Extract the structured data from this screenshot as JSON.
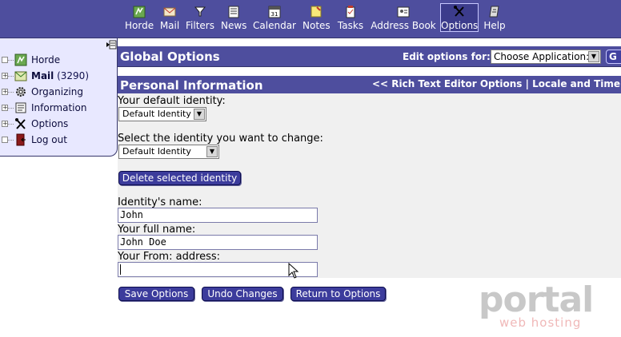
{
  "menu": {
    "items": [
      {
        "label": "Horde",
        "icon": "horde-icon"
      },
      {
        "label": "Mail",
        "icon": "mail-icon"
      },
      {
        "label": "Filters",
        "icon": "filter-icon"
      },
      {
        "label": "News",
        "icon": "news-icon"
      },
      {
        "label": "Calendar",
        "icon": "calendar-icon"
      },
      {
        "label": "Notes",
        "icon": "notes-icon"
      },
      {
        "label": "Tasks",
        "icon": "tasks-icon"
      },
      {
        "label": "Address Book",
        "icon": "address-book-icon"
      },
      {
        "label": "Options",
        "icon": "options-icon",
        "active": true
      },
      {
        "label": "Help",
        "icon": "help-icon"
      }
    ]
  },
  "sidebar": {
    "items": [
      {
        "label": "Horde"
      },
      {
        "label": "Mail",
        "count": "(3290)"
      },
      {
        "label": "Organizing"
      },
      {
        "label": "Information"
      },
      {
        "label": "Options"
      },
      {
        "label": "Log out"
      }
    ]
  },
  "global": {
    "title": "Global Options",
    "edit_for_label": "Edit options for:",
    "app_select_value": "Choose Application:",
    "go_label": "G"
  },
  "personal": {
    "title": "Personal Information",
    "crumbs": "<< Rich Text Editor Options | Locale and Time >"
  },
  "form": {
    "default_identity_label": "Your default identity:",
    "default_identity_value": "Default Identity",
    "select_identity_label": "Select the identity you want to change:",
    "select_identity_value": "Default Identity",
    "delete_button": "Delete selected identity",
    "identity_name_label": "Identity's name:",
    "identity_name_value": "John",
    "full_name_label": "Your full name:",
    "full_name_value": "John Doe",
    "from_address_label": "Your From: address:",
    "from_address_value": ""
  },
  "actions": {
    "save": "Save Options",
    "undo": "Undo Changes",
    "return": "Return to Options"
  },
  "watermark": {
    "brand": "portal",
    "sub": "web hosting"
  },
  "colors": {
    "accent": "#4e4e9e",
    "sidebar_bg": "#e8e8ff",
    "form_bg": "#f0f0f0",
    "button": "#3c3c9c"
  }
}
